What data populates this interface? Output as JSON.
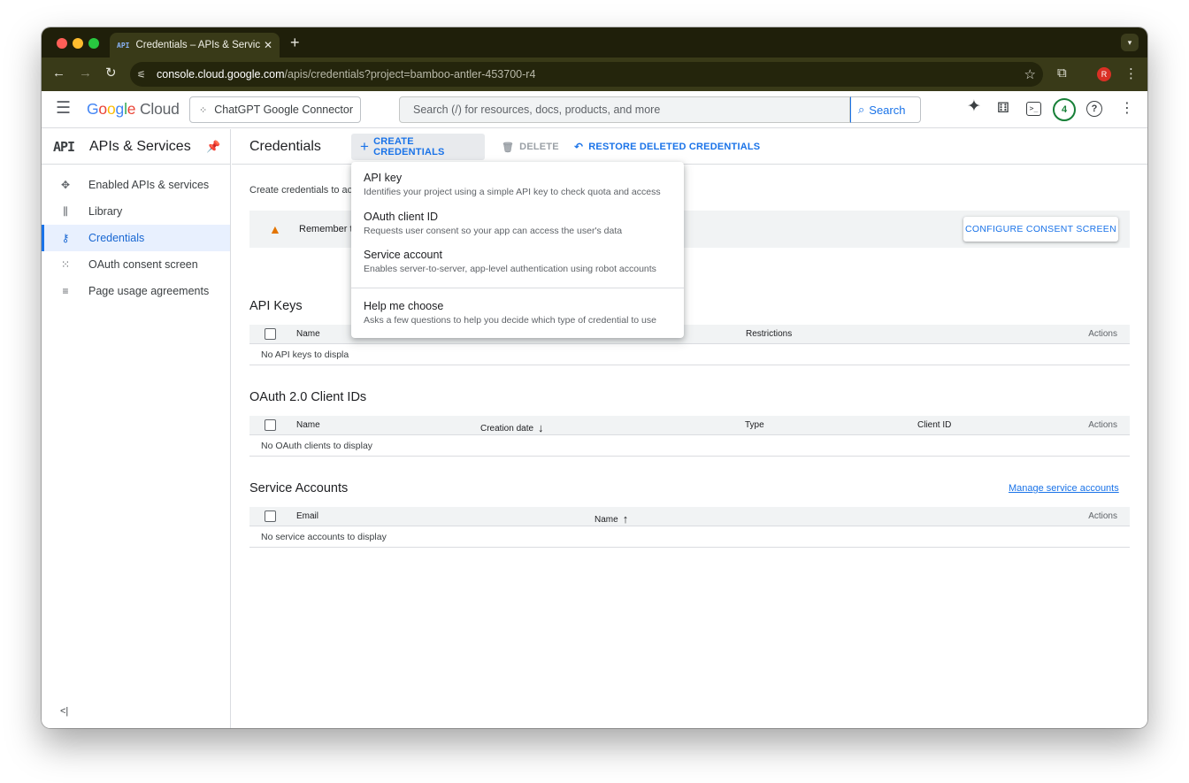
{
  "browser": {
    "tab_title": "Credentials – APIs & Services",
    "tab_favicon": "API",
    "tab_close": "✕",
    "new_tab": "+",
    "url_host": "console.cloud.google.com",
    "url_path": "/apis/credentials?project=bamboo-antler-453700-r4",
    "profile_initial": "R"
  },
  "header": {
    "logo_google": [
      "G",
      "o",
      "o",
      "g",
      "l",
      "e"
    ],
    "logo_cloud": "Cloud",
    "project_name": "ChatGPT Google Connector",
    "search_placeholder": "Search (/) for resources, docs, products, and more",
    "search_button": "Search",
    "notification_count": "4"
  },
  "sidebar": {
    "api_icon": "API",
    "title": "APIs & Services",
    "items": [
      {
        "label": "Enabled APIs & services",
        "icon": "move-icon",
        "active": false
      },
      {
        "label": "Library",
        "icon": "library-icon",
        "active": false
      },
      {
        "label": "Credentials",
        "icon": "key-icon",
        "active": true
      },
      {
        "label": "OAuth consent screen",
        "icon": "dots-grid-icon",
        "active": false
      },
      {
        "label": "Page usage agreements",
        "icon": "settings-list-icon",
        "active": false
      }
    ],
    "collapse_glyph": "<|"
  },
  "toolbar": {
    "page_title": "Credentials",
    "create_label": "CREATE CREDENTIALS",
    "delete_label": "DELETE",
    "restore_label": "RESTORE DELETED CREDENTIALS"
  },
  "main": {
    "intro_text": "Create credentials to ac",
    "banner_text": "Remember t",
    "consent_button": "CONFIGURE CONSENT SCREEN"
  },
  "api_keys": {
    "title": "API Keys",
    "columns": [
      "Name",
      "Restrictions",
      "Actions"
    ],
    "empty": "No API keys to displa"
  },
  "oauth": {
    "title": "OAuth 2.0 Client IDs",
    "columns": [
      "Name",
      "Creation date",
      "Type",
      "Client ID",
      "Actions"
    ],
    "empty": "No OAuth clients to display"
  },
  "service_accounts": {
    "title": "Service Accounts",
    "manage_link": "Manage service accounts",
    "columns": [
      "Email",
      "Name",
      "Actions"
    ],
    "empty": "No service accounts to display"
  },
  "menu": {
    "items": [
      {
        "title": "API key",
        "desc": "Identifies your project using a simple API key to check quota and access"
      },
      {
        "title": "OAuth client ID",
        "desc": "Requests user consent so your app can access the user's data"
      },
      {
        "title": "Service account",
        "desc": "Enables server-to-server, app-level authentication using robot accounts"
      },
      {
        "title": "Help me choose",
        "desc": "Asks a few questions to help you decide which type of credential to use"
      }
    ]
  },
  "colors": {
    "accent": "#1a73e8",
    "active_bg": "#e8f0fe",
    "warning": "#e37400",
    "notification_ring": "#188038",
    "browser_frame": "#393a18"
  }
}
